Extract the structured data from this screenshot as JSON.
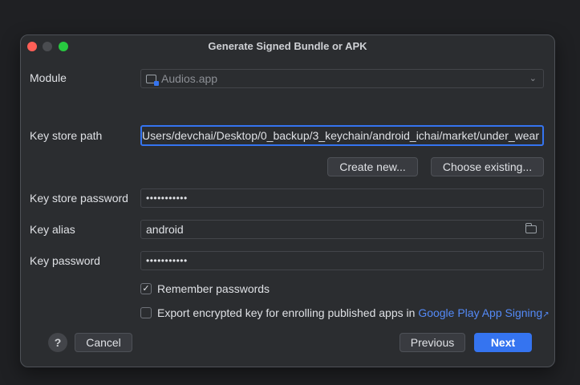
{
  "window": {
    "title": "Generate Signed Bundle or APK"
  },
  "form": {
    "module_label": "Module",
    "module_value": "Audios.app",
    "keystore_path_label": "Key store path",
    "keystore_path_value": "Users/devchai/Desktop/0_backup/3_keychain/android_ichai/market/under_wear",
    "create_new_label": "Create new...",
    "choose_existing_label": "Choose existing...",
    "keystore_password_label": "Key store password",
    "keystore_password_value": "•••••••••••",
    "key_alias_label": "Key alias",
    "key_alias_value": "android",
    "key_password_label": "Key password",
    "key_password_value": "•••••••••••",
    "remember_label": "Remember passwords",
    "remember_checked": "✓",
    "export_label": "Export encrypted key for enrolling published apps in ",
    "export_link": "Google Play App Signing",
    "export_link_icon": "↗"
  },
  "footer": {
    "help_label": "?",
    "cancel_label": "Cancel",
    "previous_label": "Previous",
    "next_label": "Next"
  },
  "icons": {
    "module": "module-icon",
    "chevron": "chevron-down-icon",
    "folder": "folder-icon",
    "external_link": "external-link-icon",
    "help": "help-icon"
  },
  "colors": {
    "background": "#1f2023",
    "dialog": "#2b2d30",
    "accent": "#3574f0",
    "link": "#548af7",
    "close": "#ff5f57",
    "maximize": "#28c840"
  }
}
